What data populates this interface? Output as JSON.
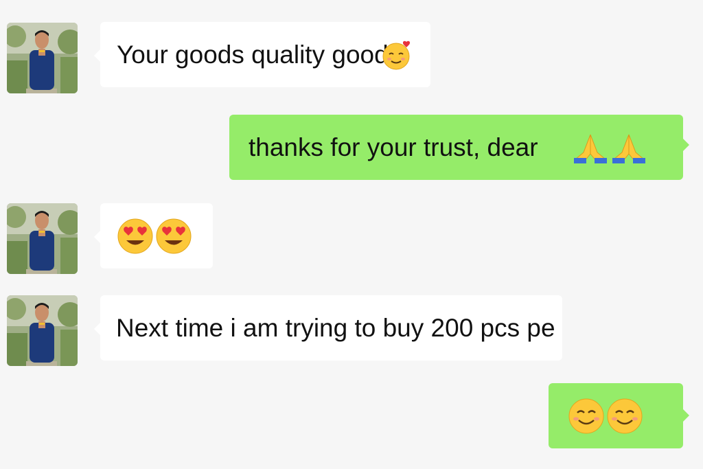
{
  "messages": [
    {
      "id": "m1",
      "side": "incoming",
      "text": "Your goods quality good",
      "emoji": "smiling-face-with-heart-icon"
    },
    {
      "id": "m2",
      "side": "outgoing",
      "text": "thanks for your trust, dear",
      "emoji": "folded-hands-icon"
    },
    {
      "id": "m3",
      "side": "incoming",
      "text": "",
      "emoji": "heart-eyes-icon"
    },
    {
      "id": "m4",
      "side": "incoming",
      "text": "Next time i am trying to buy 200 pcs pe",
      "emoji": ""
    },
    {
      "id": "m5",
      "side": "outgoing",
      "text": "",
      "emoji": "smiling-face-icon"
    }
  ],
  "colors": {
    "background": "#f6f6f6",
    "incoming_bubble": "#ffffff",
    "outgoing_bubble": "#95ec69",
    "text": "#111111"
  }
}
